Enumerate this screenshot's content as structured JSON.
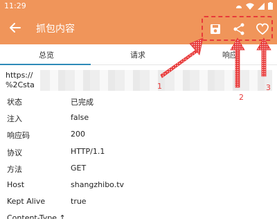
{
  "status": {
    "time": "11:29"
  },
  "appbar": {
    "title": "抓包内容"
  },
  "tabs": [
    "总览",
    "请求",
    "响应"
  ],
  "url_fragments": [
    "https://",
    "%2Csta"
  ],
  "rows": [
    {
      "key": "状态",
      "value": "已完成"
    },
    {
      "key": "注入",
      "value": "false"
    },
    {
      "key": "响应码",
      "value": "200"
    },
    {
      "key": "协议",
      "value": "HTTP/1.1"
    },
    {
      "key": "方法",
      "value": "GET"
    },
    {
      "key": "Host",
      "value": "shangzhibo.tv"
    },
    {
      "key": "Kept Alive",
      "value": "true"
    },
    {
      "key": "Content-Type ↑",
      "value": ""
    }
  ],
  "annotations": [
    "1",
    "2",
    "3"
  ],
  "colors": {
    "appbar": "#f0955a",
    "annotation": "#e83a3a",
    "tab_indicator": "#2e8bb8"
  },
  "icons": {
    "back": "arrow-left",
    "save": "floppy-disk",
    "share": "share",
    "favorite": "heart-outline"
  }
}
